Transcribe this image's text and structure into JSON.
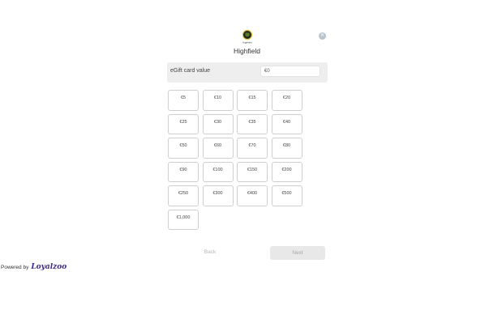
{
  "brand": {
    "name": "Highfield",
    "logo_text": "Highfield"
  },
  "close_icon": "close-icon",
  "value": {
    "label": "eGift card value",
    "input_value": "€0"
  },
  "amounts": [
    "€5",
    "€10",
    "€15",
    "€20",
    "€25",
    "€30",
    "€35",
    "€40",
    "€50",
    "€60",
    "€70",
    "€80",
    "€90",
    "€100",
    "€150",
    "€200",
    "€250",
    "€300",
    "€400",
    "€500",
    "€1,000"
  ],
  "nav": {
    "back_label": "Back",
    "next_label": "Next"
  },
  "footer": {
    "powered_by": "Powered by",
    "wordmark": "Loyalzoo"
  },
  "colors": {
    "panel": "#eeeeee",
    "next_bg": "#e8e8e8",
    "wordmark": "#3f2a8c"
  }
}
